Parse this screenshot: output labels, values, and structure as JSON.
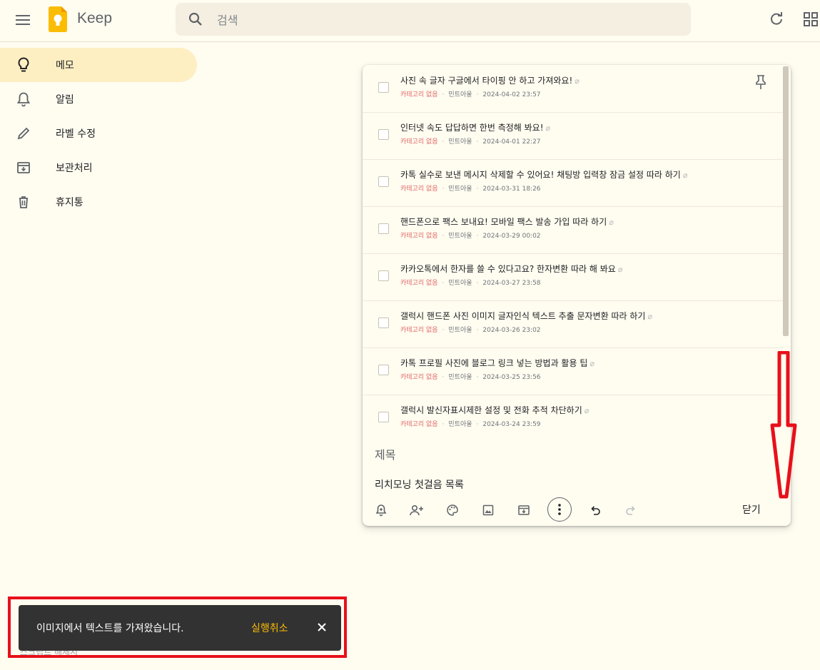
{
  "header": {
    "app_title": "Keep",
    "search_placeholder": "검색"
  },
  "sidebar": {
    "items": [
      {
        "label": "메모",
        "icon": "lightbulb-icon",
        "active": true
      },
      {
        "label": "알림",
        "icon": "bell-icon",
        "active": false
      },
      {
        "label": "라벨 수정",
        "icon": "pencil-icon",
        "active": false
      },
      {
        "label": "보관처리",
        "icon": "archive-icon",
        "active": false
      },
      {
        "label": "휴지통",
        "icon": "trash-icon",
        "active": false
      }
    ]
  },
  "note": {
    "items": [
      {
        "text": "사진 속 글자 구글에서 타이핑 안 하고 가져와요!",
        "category": "카테고리 없음",
        "author": "민트아울",
        "date": "2024-04-02 23:57"
      },
      {
        "text": "인터넷 속도 답답하면 한번 측정해 봐요!",
        "category": "카테고리 없음",
        "author": "민트아울",
        "date": "2024-04-01 22:27"
      },
      {
        "text": "카톡 실수로 보낸 메시지 삭제할 수 있어요! 채팅방 입력창 잠금 설정 따라 하기",
        "category": "카테고리 없음",
        "author": "민트아울",
        "date": "2024-03-31 18:26"
      },
      {
        "text": "핸드폰으로 팩스 보내요! 모바일 팩스 발송 가입 따라 하기",
        "category": "카테고리 없음",
        "author": "민트아울",
        "date": "2024-03-29 00:02"
      },
      {
        "text": "카카오톡에서 한자를 쓸 수 있다고요? 한자변환 따라 해 봐요",
        "category": "카테고리 없음",
        "author": "민트아울",
        "date": "2024-03-27 23:58"
      },
      {
        "text": "갤럭시 핸드폰 사진 이미지 글자인식 텍스트 추출 문자변환 따라 하기",
        "category": "카테고리 없음",
        "author": "민트아울",
        "date": "2024-03-26 23:02"
      },
      {
        "text": "카톡 프로필 사진에 블로그 링크 넣는 방법과 활용 팁",
        "category": "카테고리 없음",
        "author": "민트아울",
        "date": "2024-03-25 23:56"
      },
      {
        "text": "갤럭시 발신자표시제한 설정 및 전화 추적 차단하기",
        "category": "카테고리 없음",
        "author": "민트아울",
        "date": "2024-03-24 23:59"
      }
    ],
    "title_placeholder": "제목",
    "body": "리치모닝 첫걸음 목록",
    "close_label": "닫기"
  },
  "snackbar": {
    "message": "이미지에서 텍스트를 가져왔습니다.",
    "undo_label": "실행취소",
    "obscured_text": "스크립트 해제시"
  },
  "colors": {
    "background": "#fffcf0",
    "active_nav": "#feefc3",
    "snackbar_bg": "#323232",
    "undo": "#fbbc04",
    "category": "#e06666",
    "annotation_red": "#e8101a"
  }
}
